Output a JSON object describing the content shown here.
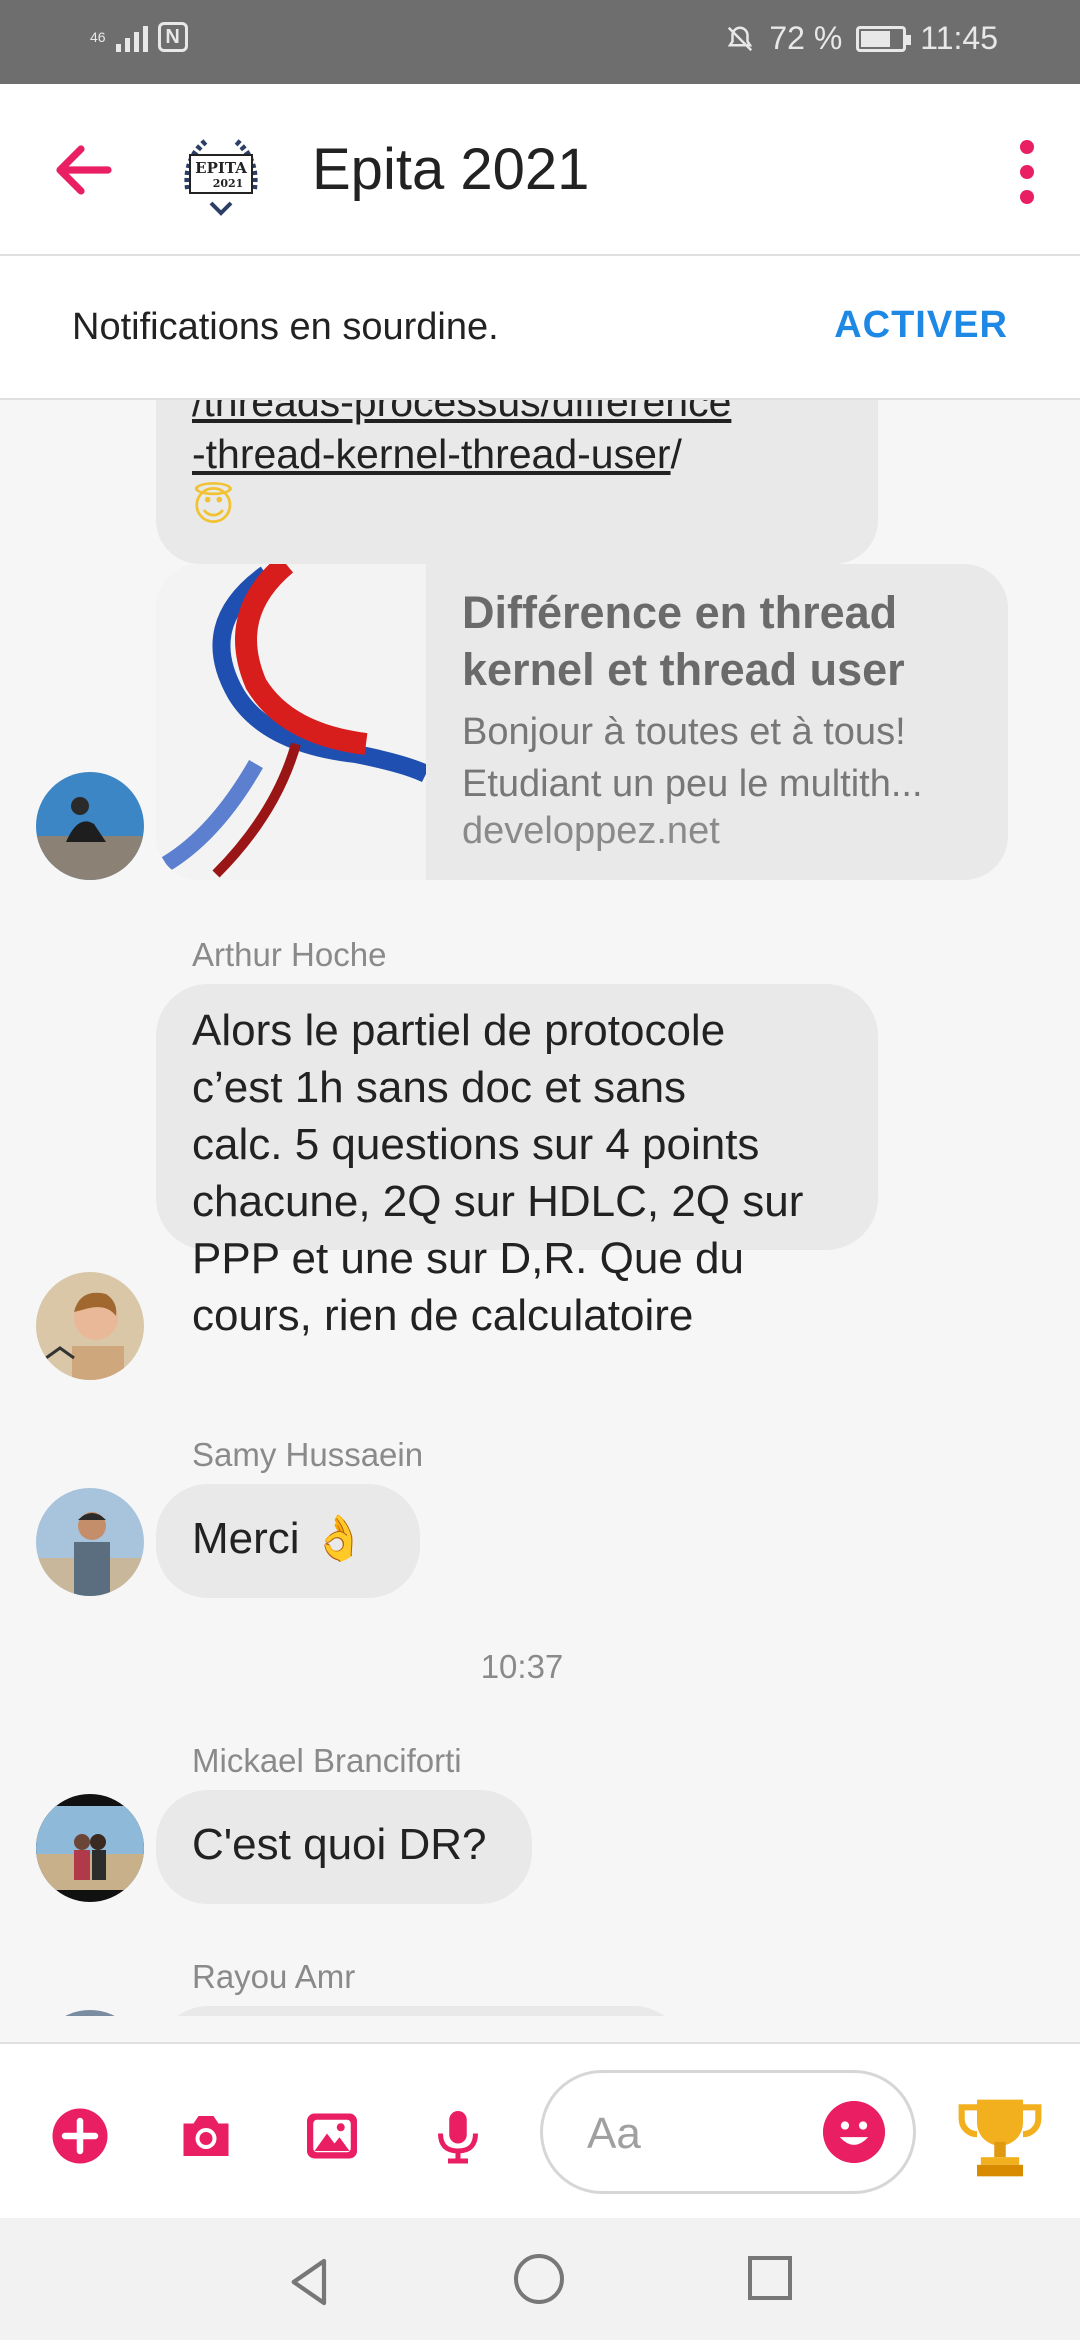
{
  "status_bar": {
    "network": "46",
    "battery_percent": "72 %",
    "battery_level": 0.72,
    "time": "11:45"
  },
  "header": {
    "title": "Epita 2021",
    "logo_text": "EPITA",
    "logo_year": "2021"
  },
  "banner": {
    "text": "Notifications en sourdine.",
    "action": "ACTIVER"
  },
  "messages": {
    "link_line1": "/threads-processus/difference",
    "link_line2": "-thread-kernel-thread-user",
    "link_suffix": "/",
    "link_emoji": "😇",
    "card": {
      "title": "Différence en thread kernel et thread user",
      "desc_line1": "Bonjour à toutes et à tous!",
      "desc_line2": "Etudiant un peu le multith...",
      "domain": "developpez.net"
    },
    "arthur": {
      "name": "Arthur Hoche",
      "lines": [
        "Alors le partiel de protocole",
        "c’est 1h sans doc et sans",
        "calc. 5 questions sur 4 points",
        "chacune, 2Q sur HDLC, 2Q sur",
        "PPP et une sur D,R. Que du",
        "cours, rien de calculatoire"
      ]
    },
    "samy": {
      "name": "Samy Hussaein",
      "text": "Merci",
      "emoji": "👌"
    },
    "timestamp": "10:37",
    "mickael": {
      "name": "Mickael Branciforti",
      "text": "C'est quoi DR?"
    },
    "rayou": {
      "name": "Rayou Amr"
    }
  },
  "composer": {
    "placeholder": "Aa",
    "trophy_emoji": "🏆"
  },
  "colors": {
    "accent": "#e91e63",
    "action_blue": "#1e88e5",
    "bubble": "#e9e9e9"
  },
  "icons": [
    "back-arrow-icon",
    "more-vert-icon",
    "plus-circle-icon",
    "camera-icon",
    "image-icon",
    "microphone-icon",
    "emoji-icon",
    "trophy-icon",
    "nav-back-icon",
    "nav-home-icon",
    "nav-recents-icon"
  ]
}
